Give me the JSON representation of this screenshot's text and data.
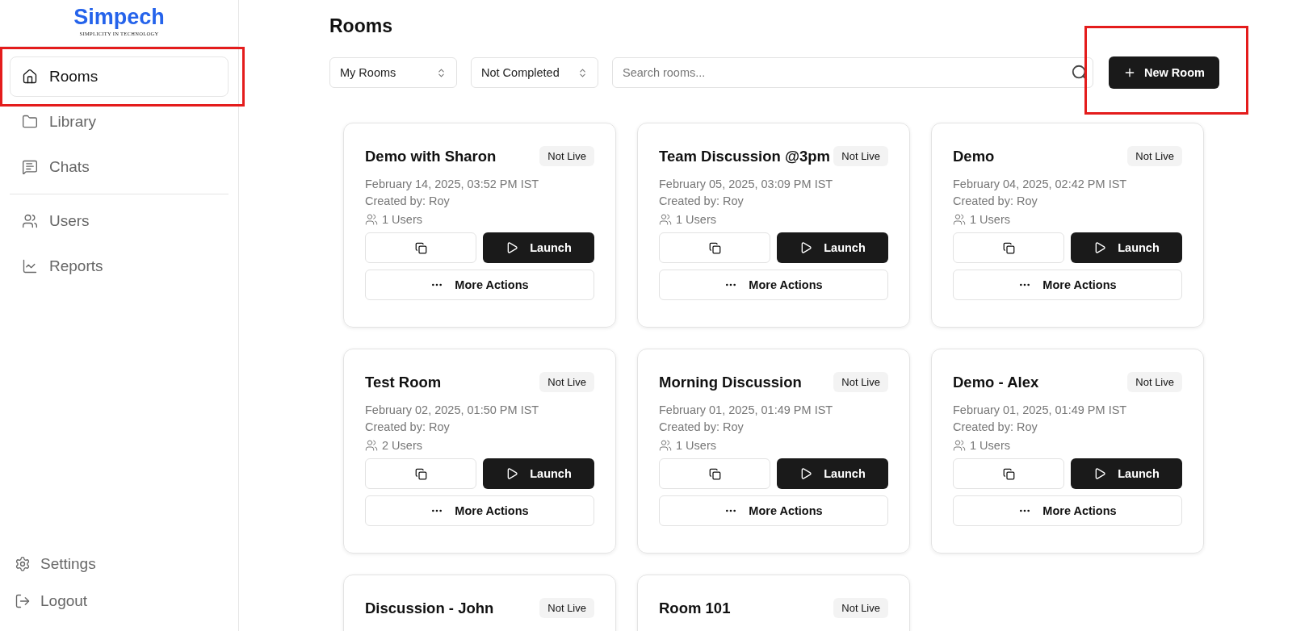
{
  "logo": {
    "name": "Simpech",
    "tagline": "SIMPLICITY IN TECHNOLOGY"
  },
  "nav_groups": [
    {
      "items": [
        {
          "label": "Rooms",
          "selected": true,
          "highlighted": true
        },
        {
          "label": "Library",
          "selected": false,
          "highlighted": false
        },
        {
          "label": "Chats",
          "selected": false,
          "highlighted": false
        }
      ]
    },
    {
      "items": [
        {
          "label": "Users",
          "selected": false,
          "highlighted": false
        },
        {
          "label": "Reports",
          "selected": false,
          "highlighted": false
        }
      ]
    }
  ],
  "footer_nav": [
    {
      "label": "Settings"
    },
    {
      "label": "Logout"
    }
  ],
  "page_title": "Rooms",
  "filters": [
    {
      "value": "My Rooms"
    },
    {
      "value": "Not Completed"
    }
  ],
  "search": {
    "placeholder": "Search rooms..."
  },
  "new_room_button": {
    "label": "New Room",
    "highlighted": true
  },
  "rooms": [
    {
      "title": "Demo with Sharon",
      "status": "Not Live",
      "date": "February 14, 2025, 03:52 PM IST",
      "creator": "Created by: Roy",
      "users": "1 Users",
      "launch": "Launch",
      "more": "More Actions"
    },
    {
      "title": "Team Discussion @3pm",
      "status": "Not Live",
      "date": "February 05, 2025, 03:09 PM IST",
      "creator": "Created by: Roy",
      "users": "1 Users",
      "launch": "Launch",
      "more": "More Actions"
    },
    {
      "title": "Demo",
      "status": "Not Live",
      "date": "February 04, 2025, 02:42 PM IST",
      "creator": "Created by: Roy",
      "users": "1 Users",
      "launch": "Launch",
      "more": "More Actions"
    },
    {
      "title": "Test Room",
      "status": "Not Live",
      "date": "February 02, 2025, 01:50 PM IST",
      "creator": "Created by: Roy",
      "users": "2 Users",
      "launch": "Launch",
      "more": "More Actions"
    },
    {
      "title": "Morning Discussion",
      "status": "Not Live",
      "date": "February 01, 2025, 01:49 PM IST",
      "creator": "Created by: Roy",
      "users": "1 Users",
      "launch": "Launch",
      "more": "More Actions"
    },
    {
      "title": "Demo - Alex",
      "status": "Not Live",
      "date": "February 01, 2025, 01:49 PM IST",
      "creator": "Created by: Roy",
      "users": "1 Users",
      "launch": "Launch",
      "more": "More Actions"
    },
    {
      "title": "Discussion - John",
      "status": "Not Live"
    },
    {
      "title": "Room 101",
      "status": "Not Live"
    }
  ]
}
